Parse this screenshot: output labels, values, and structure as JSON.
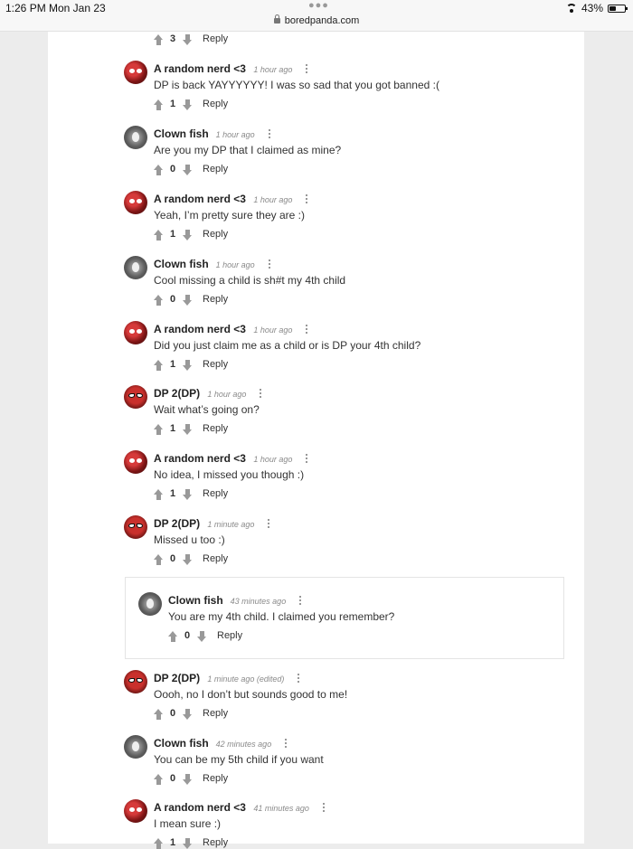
{
  "status_bar": {
    "time": "1:26 PM",
    "date": "Mon Jan 23",
    "url": "boredpanda.com",
    "battery": "43%",
    "battery_level": 0.43
  },
  "top_item": {
    "votes": "3",
    "reply": "Reply"
  },
  "comments": [
    {
      "author": "A random nerd <3",
      "time": "1 hour ago",
      "text": "DP is back YAYYYYYY! I was so sad that you got banned :(",
      "votes": "1",
      "reply": "Reply",
      "avatar": "nerd"
    },
    {
      "author": "Clown fish",
      "time": "1 hour ago",
      "text": "Are you my DP that I claimed as mine?",
      "votes": "0",
      "reply": "Reply",
      "avatar": "fish"
    },
    {
      "author": "A random nerd <3",
      "time": "1 hour ago",
      "text": "Yeah, I’m pretty sure they are :)",
      "votes": "1",
      "reply": "Reply",
      "avatar": "nerd"
    },
    {
      "author": "Clown fish",
      "time": "1 hour ago",
      "text": "Cool missing a child is sh#t my 4th child",
      "votes": "0",
      "reply": "Reply",
      "avatar": "fish"
    },
    {
      "author": "A random nerd <3",
      "time": "1 hour ago",
      "text": "Did you just claim me as a child or is DP your 4th child?",
      "votes": "1",
      "reply": "Reply",
      "avatar": "nerd"
    },
    {
      "author": "DP 2(DP)",
      "time": "1 hour ago",
      "text": "Wait what’s going on?",
      "votes": "1",
      "reply": "Reply",
      "avatar": "dp"
    },
    {
      "author": "A random nerd <3",
      "time": "1 hour ago",
      "text": "No idea, I missed you though :)",
      "votes": "1",
      "reply": "Reply",
      "avatar": "nerd"
    },
    {
      "author": "DP 2(DP)",
      "time": "1 minute ago",
      "text": "Missed u too :)",
      "votes": "0",
      "reply": "Reply",
      "avatar": "dp"
    },
    {
      "author": "Clown fish",
      "time": "43 minutes ago",
      "text": "You are my 4th child. I claimed you remember?",
      "votes": "0",
      "reply": "Reply",
      "avatar": "fish"
    },
    {
      "author": "DP 2(DP)",
      "time": "1 minute ago (edited)",
      "text": "Oooh, no I don’t but sounds good to me!",
      "votes": "0",
      "reply": "Reply",
      "avatar": "dp"
    },
    {
      "author": "Clown fish",
      "time": "42 minutes ago",
      "text": "You can be my 5th child if you want",
      "votes": "0",
      "reply": "Reply",
      "avatar": "fish"
    },
    {
      "author": "A random nerd <3",
      "time": "41 minutes ago",
      "text": "I mean sure :)",
      "votes": "1",
      "reply": "Reply",
      "avatar": "nerd"
    }
  ]
}
